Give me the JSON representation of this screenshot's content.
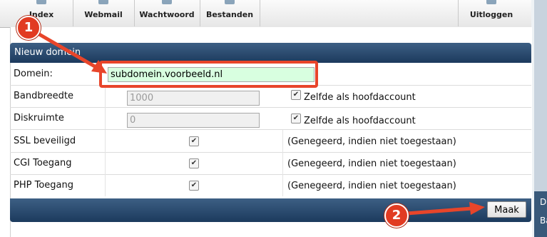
{
  "nav": {
    "items": [
      {
        "label": "Index",
        "icon": "home-icon"
      },
      {
        "label": "Webmail",
        "icon": "mail-icon"
      },
      {
        "label": "Wachtwoord",
        "icon": "key-icon"
      },
      {
        "label": "Bestanden",
        "icon": "folder-icon"
      },
      {
        "label": "Uitloggen",
        "icon": "logout-icon"
      }
    ]
  },
  "form": {
    "title": "Nieuw domein",
    "domain": {
      "label": "Domein:",
      "value": "subdomein.voorbeeld.nl"
    },
    "bandwidth": {
      "label": "Bandbreedte",
      "value": "1000",
      "checkbox_label": "Zelfde als hoofdaccount",
      "checked": true
    },
    "diskspace": {
      "label": "Diskruimte",
      "value": "0",
      "checkbox_label": "Zelfde als hoofdaccount",
      "checked": true
    },
    "ssl": {
      "label": "SSL beveiligd",
      "note": "(Genegeerd, indien niet toegestaan)",
      "checked": true
    },
    "cgi": {
      "label": "CGI Toegang",
      "note": "(Genegeerd, indien niet toegestaan)",
      "checked": true
    },
    "php": {
      "label": "PHP Toegang",
      "note": "(Genegeerd, indien niet toegestaan)",
      "checked": true
    },
    "submit_label": "Maak"
  },
  "annotations": {
    "step1": "1",
    "step2": "2"
  },
  "side_panel": {
    "letters": [
      "D",
      "Ba"
    ]
  },
  "colors": {
    "header": "#1c3a5d",
    "highlight": "#e8452a",
    "badge": "#e13b22",
    "domain_bg": "#d8ffe0"
  }
}
